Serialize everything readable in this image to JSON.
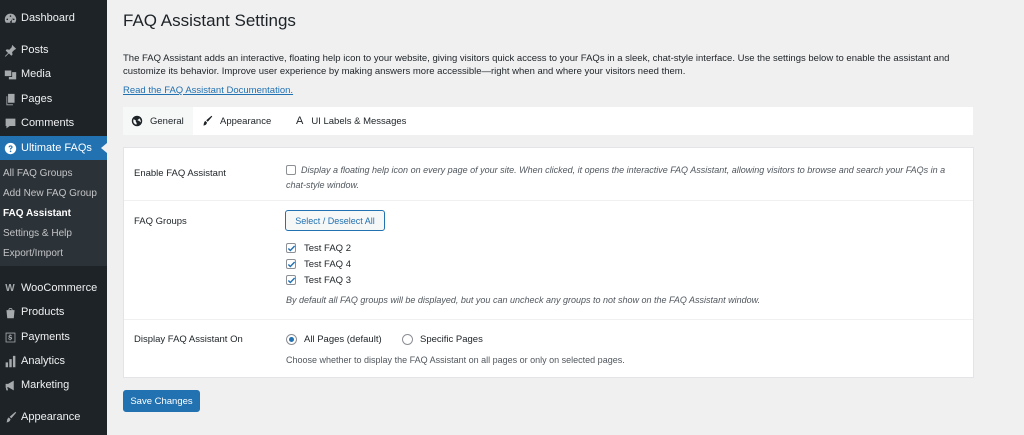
{
  "sidebar": {
    "items": [
      {
        "label": "Dashboard",
        "icon": "dashboard-icon"
      },
      {
        "label": "Posts",
        "icon": "pin-icon"
      },
      {
        "label": "Media",
        "icon": "media-icon"
      },
      {
        "label": "Pages",
        "icon": "pages-icon"
      },
      {
        "label": "Comments",
        "icon": "comments-icon"
      },
      {
        "label": "Ultimate FAQs",
        "icon": "question-icon"
      },
      {
        "label": "WooCommerce",
        "icon": "woocommerce-icon"
      },
      {
        "label": "Products",
        "icon": "products-icon"
      },
      {
        "label": "Payments",
        "icon": "payments-icon"
      },
      {
        "label": "Analytics",
        "icon": "analytics-icon"
      },
      {
        "label": "Marketing",
        "icon": "megaphone-icon"
      },
      {
        "label": "Appearance",
        "icon": "brush-icon"
      }
    ],
    "submenu": [
      {
        "label": "All FAQ Groups"
      },
      {
        "label": "Add New FAQ Group"
      },
      {
        "label": "FAQ Assistant"
      },
      {
        "label": "Settings & Help"
      },
      {
        "label": "Export/Import"
      }
    ],
    "accent_color": "#2271b1"
  },
  "page": {
    "title": "FAQ Assistant Settings",
    "description": "The FAQ Assistant adds an interactive, floating help icon to your website, giving visitors quick access to your FAQs in a sleek, chat-style interface. Use the settings below to enable the assistant and customize its behavior. Improve user experience by making answers more accessible—right when and where your visitors need them.",
    "doc_link": "Read the FAQ Assistant Documentation."
  },
  "tabs": [
    {
      "label": "General",
      "icon": "globe-icon"
    },
    {
      "label": "Appearance",
      "icon": "brush-icon"
    },
    {
      "label": "UI Labels & Messages",
      "icon": "text-icon",
      "glyph": "A"
    }
  ],
  "settings": {
    "enable": {
      "label": "Enable FAQ Assistant",
      "description": "Display a floating help icon on every page of your site. When clicked, it opens the interactive FAQ Assistant, allowing visitors to browse and search your FAQs in a chat-style window.",
      "checked": false
    },
    "groups": {
      "label": "FAQ Groups",
      "select_all": "Select / Deselect All",
      "options": [
        {
          "label": "Test FAQ 2",
          "checked": true
        },
        {
          "label": "Test FAQ 4",
          "checked": true
        },
        {
          "label": "Test FAQ 3",
          "checked": true
        }
      ],
      "description": "By default all FAQ groups will be displayed, but you can uncheck any groups to not show on the FAQ Assistant window."
    },
    "display_on": {
      "label": "Display FAQ Assistant On",
      "options": [
        {
          "label": "All Pages (default)",
          "checked": true
        },
        {
          "label": "Specific Pages",
          "checked": false
        }
      ],
      "description": "Choose whether to display the FAQ Assistant on all pages or only on selected pages."
    }
  },
  "save_label": "Save Changes"
}
